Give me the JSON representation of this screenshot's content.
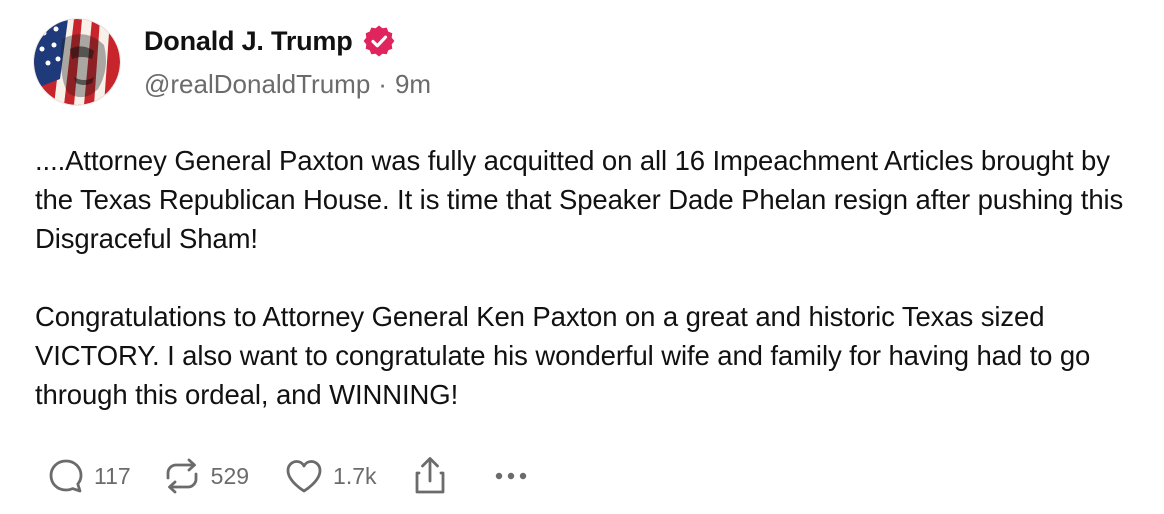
{
  "post": {
    "author": {
      "display_name": "Donald J. Trump",
      "verified_icon": "verified-badge-icon",
      "verified_color": "#E0245E",
      "handle": "@realDonaldTrump",
      "separator": "·",
      "time": "9m"
    },
    "paragraphs": [
      "....Attorney General Paxton was fully acquitted on all 16 Impeachment Articles brought by the Texas Republican House. It is time that Speaker Dade Phelan resign after pushing this Disgraceful Sham!",
      "Congratulations to Attorney General Ken Paxton on a great and historic Texas sized VICTORY. I also want to congratulate his wonderful wife and family for having had to go through this ordeal, and WINNING!"
    ],
    "actions": {
      "reply": {
        "icon": "reply-icon",
        "count": "117"
      },
      "repost": {
        "icon": "repost-icon",
        "count": "529"
      },
      "like": {
        "icon": "heart-icon",
        "count": "1.7k"
      },
      "share": {
        "icon": "share-icon"
      },
      "more": {
        "icon": "more-icon"
      }
    }
  },
  "colors": {
    "text": "#111111",
    "muted": "#6b6b6b",
    "background": "#ffffff"
  }
}
